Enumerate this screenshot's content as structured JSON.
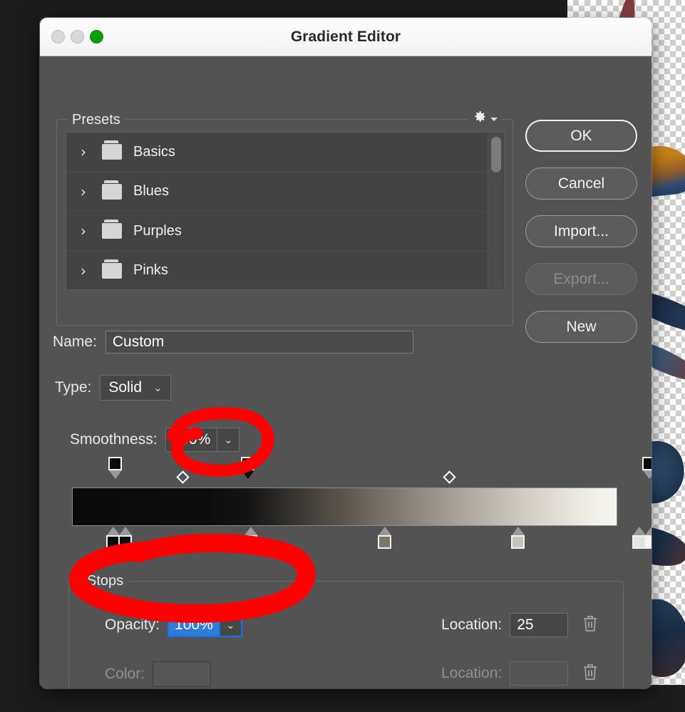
{
  "window": {
    "title": "Gradient Editor",
    "traffic_lights": [
      "close-button",
      "minimize-button",
      "zoom-button"
    ]
  },
  "presets": {
    "title": "Presets",
    "gear_icon": "gear-icon",
    "items": [
      {
        "label": "Basics",
        "icon": "folder-icon",
        "chevron": "chevron-right-icon"
      },
      {
        "label": "Blues",
        "icon": "folder-icon",
        "chevron": "chevron-right-icon"
      },
      {
        "label": "Purples",
        "icon": "folder-icon",
        "chevron": "chevron-right-icon"
      },
      {
        "label": "Pinks",
        "icon": "folder-icon",
        "chevron": "chevron-right-icon"
      }
    ]
  },
  "buttons": {
    "ok": "OK",
    "cancel": "Cancel",
    "import": "Import...",
    "export": "Export...",
    "new": "New"
  },
  "fields": {
    "name_label": "Name:",
    "name_value": "Custom",
    "type_label": "Type:",
    "type_value": "Solid",
    "smoothness_label": "Smoothness:",
    "smoothness_value": "100%",
    "caret": "⌄"
  },
  "stops": {
    "title": "Stops",
    "opacity_label": "Opacity:",
    "opacity_value": "100%",
    "location_label_1": "Location:",
    "location_value_1": "25",
    "color_label": "Color:",
    "location_label_2": "Location:",
    "location_value_2": "",
    "delete_icon": "trash-icon"
  },
  "gradient": {
    "opacity_stops": [
      {
        "position_pct": 0,
        "opacity": "100%",
        "selected": false
      },
      {
        "position_pct": 25,
        "opacity": "100%",
        "selected": true
      },
      {
        "position_pct": 100,
        "opacity": "100%",
        "selected": false
      }
    ],
    "opacity_midpoints": [
      {
        "position_pct": 13
      },
      {
        "position_pct": 62
      }
    ],
    "color_stops": [
      {
        "position_pct": 0,
        "color": "#0a0a0a"
      },
      {
        "position_pct": 2,
        "color": "#111111"
      },
      {
        "position_pct": 25,
        "color": "#1a1a1a"
      },
      {
        "position_pct": 49,
        "color": "#7d7568"
      },
      {
        "position_pct": 74,
        "color": "#c8c3b8"
      },
      {
        "position_pct": 97,
        "color": "#e6e3dc"
      },
      {
        "position_pct": 100,
        "color": "#f7f5f0"
      }
    ]
  },
  "colors": {
    "panel_bg": "#535353",
    "list_bg": "#434343",
    "accent_blue": "#1473e6",
    "selection_blue": "#2f7cd6",
    "annotation_red": "#fd0000",
    "title_bar": "#f6f6f6"
  },
  "annotations": [
    {
      "name": "circle-around-selected-opacity-stop",
      "color": "#fd0000"
    },
    {
      "name": "circle-around-opacity-field",
      "color": "#fd0000"
    }
  ]
}
